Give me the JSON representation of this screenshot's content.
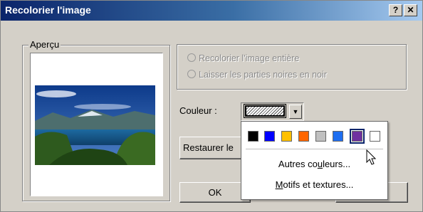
{
  "window": {
    "title": "Recolorier l'image",
    "help_label": "?",
    "close_label": "✕"
  },
  "preview": {
    "group_label": "Aperçu",
    "image_icon": "landscape-photo"
  },
  "options": {
    "recolor_all": "Recolorier l'image entière",
    "keep_black": "Laisser les parties noires en noir"
  },
  "color": {
    "label": "Couleur :",
    "arrow": "▼"
  },
  "buttons": {
    "restore": "Restaurer le",
    "ok": "OK",
    "cancel_partial": "er"
  },
  "palette": {
    "swatches": [
      "#000000",
      "#0000ff",
      "#ffc000",
      "#ff6600",
      "#c0c0c0",
      "#1e6ef0",
      "#7030a0",
      "#ffffff"
    ],
    "selected_index": 6
  },
  "menu": {
    "more_colors_pre": "Autres co",
    "more_colors_u": "u",
    "more_colors_post": "leurs...",
    "patterns_u": "M",
    "patterns_post": "otifs et textures..."
  },
  "cursor": {
    "icon": "mouse-pointer-icon"
  }
}
